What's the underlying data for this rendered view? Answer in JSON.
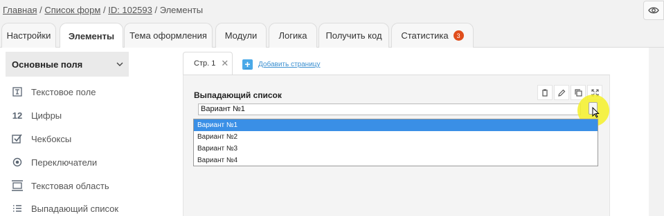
{
  "breadcrumb": {
    "home": "Главная",
    "forms": "Список форм",
    "id": "ID: 102593",
    "current": "Элементы",
    "separator": "/"
  },
  "tabs": [
    {
      "label": "Настройки"
    },
    {
      "label": "Элементы",
      "active": true
    },
    {
      "label": "Тема оформления"
    },
    {
      "label": "Модули"
    },
    {
      "label": "Логика"
    },
    {
      "label": "Получить код"
    },
    {
      "label": "Статистика",
      "badge": "3"
    }
  ],
  "sidebar": {
    "header": "Основные поля",
    "items": [
      {
        "label": "Текстовое поле",
        "icon": "text-field-icon"
      },
      {
        "label": "Цифры",
        "icon": "numbers-icon",
        "glyph": "12"
      },
      {
        "label": "Чекбоксы",
        "icon": "checkbox-icon"
      },
      {
        "label": "Переключатели",
        "icon": "radio-icon"
      },
      {
        "label": "Текстовая область",
        "icon": "textarea-icon"
      },
      {
        "label": "Выпадающий список",
        "icon": "list-icon"
      }
    ]
  },
  "pages": {
    "tab_label": "Стр. 1",
    "add_label": "Добавить страницу"
  },
  "field": {
    "label": "Выпадающий список",
    "selected": "Вариант №1",
    "options": [
      "Вариант №1",
      "Вариант №2",
      "Вариант №3",
      "Вариант №4"
    ]
  },
  "colors": {
    "accent": "#3a8fe6",
    "badge": "#e04e1c",
    "cursor_highlight": "#f5f028"
  }
}
